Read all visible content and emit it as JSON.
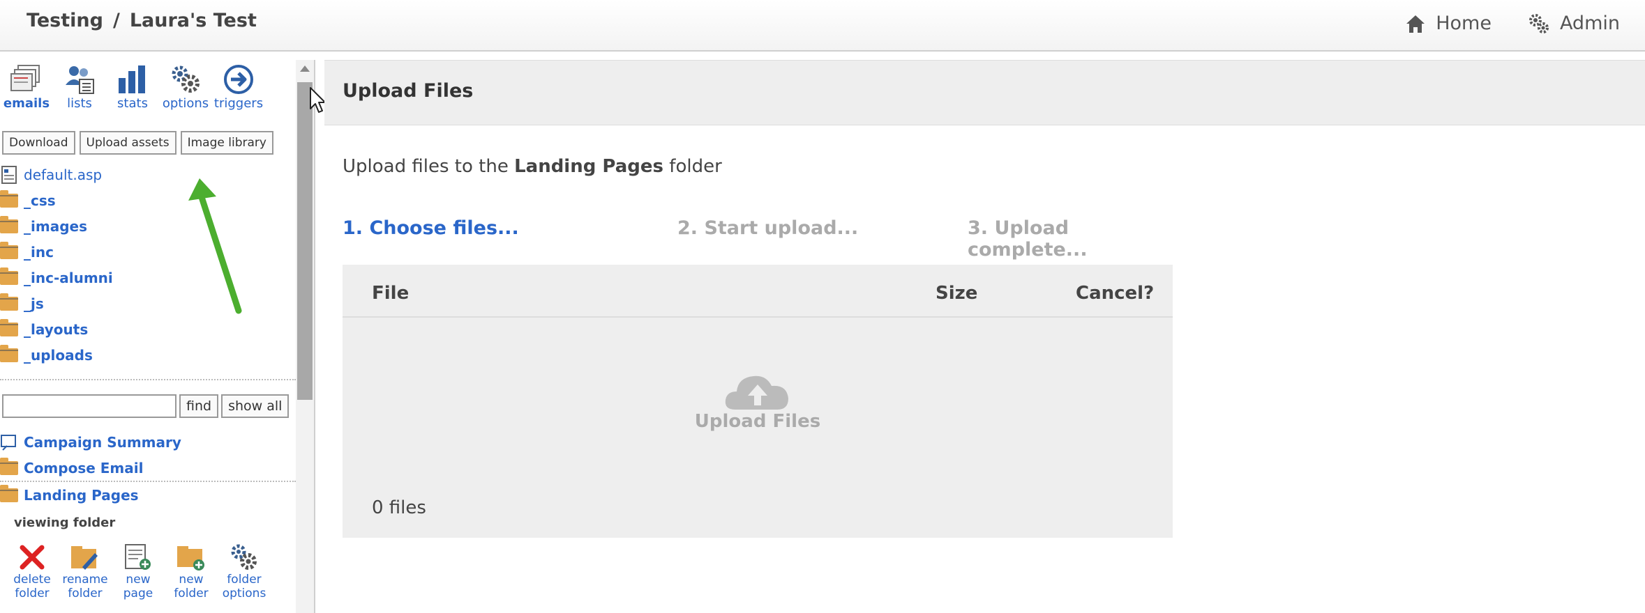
{
  "breadcrumb": {
    "parent": "Testing",
    "separator": "/",
    "current": "Laura's Test"
  },
  "topnav": {
    "home": "Home",
    "admin": "Admin"
  },
  "toolbar": {
    "emails": "emails",
    "lists": "lists",
    "stats": "stats",
    "options": "options",
    "triggers": "triggers"
  },
  "buttons": {
    "download": "Download",
    "upload_assets": "Upload assets",
    "image_library": "Image library"
  },
  "files": [
    {
      "name": "default.asp"
    },
    {
      "name": "_css"
    },
    {
      "name": "_images"
    },
    {
      "name": "_inc"
    },
    {
      "name": "_inc-alumni"
    },
    {
      "name": "_js"
    },
    {
      "name": "_layouts"
    },
    {
      "name": "_uploads"
    }
  ],
  "search": {
    "placeholder": "",
    "find": "find",
    "show_all": "show all"
  },
  "nav": {
    "campaign_summary": "Campaign Summary",
    "compose_email": "Compose Email",
    "landing_pages": "Landing Pages"
  },
  "viewing": "viewing  folder",
  "folder_actions": {
    "delete_1": "delete",
    "delete_2": "folder",
    "rename_1": "rename",
    "rename_2": "folder",
    "newpage_1": "new",
    "newpage_2": "page",
    "newfolder_1": "new",
    "newfolder_2": "folder",
    "options_1": "folder",
    "options_2": "options"
  },
  "main": {
    "title": "Upload Files",
    "desc_prefix": "Upload files to the ",
    "desc_folder": "Landing Pages",
    "desc_suffix": " folder",
    "step1": "1. Choose files...",
    "step2": "2. Start upload...",
    "step3": "3. Upload complete...",
    "col_file": "File",
    "col_size": "Size",
    "col_cancel": "Cancel?",
    "drop_label": "Upload Files",
    "file_count": "0 files"
  },
  "colors": {
    "link": "#2a66c9",
    "arrow": "#4cae2f",
    "muted": "#aaaaaa"
  }
}
